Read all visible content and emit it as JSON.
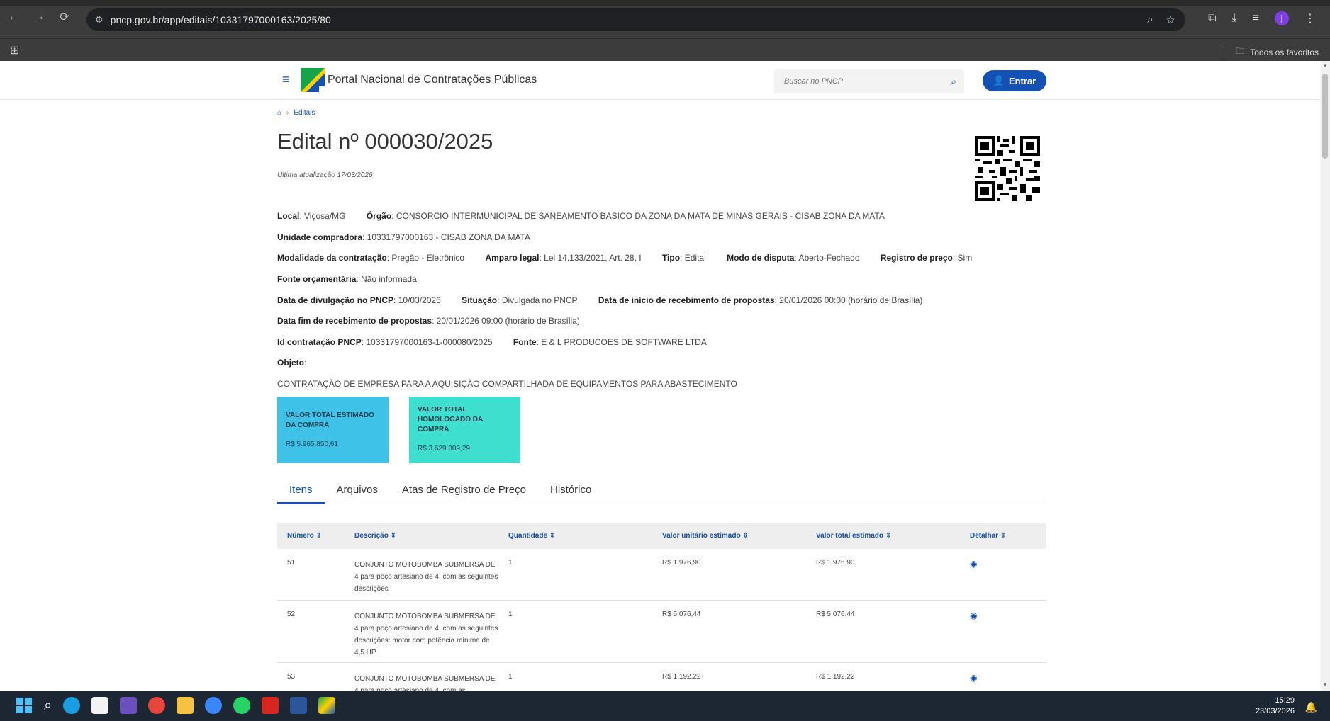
{
  "browser": {
    "url": "pncp.gov.br/app/editais/10331797000163/2025/80",
    "favorites_label": "Todos os favoritos",
    "profile_initial": "j"
  },
  "header": {
    "brand": "Portal Nacional de Contratações Públicas",
    "search_placeholder": "Buscar no PNCP",
    "login_label": "Entrar"
  },
  "breadcrumb": {
    "current": "Editais"
  },
  "edital": {
    "title": "Edital nº 000030/2025",
    "updated": "Última atualização 17/03/2026",
    "fields": {
      "local_label": "Local",
      "local": "Viçosa/MG",
      "orgao_label": "Órgão",
      "orgao": "CONSORCIO INTERMUNICIPAL DE SANEAMENTO BASICO DA ZONA DA MATA DE MINAS GERAIS - CISAB ZONA DA MATA",
      "unidade_label": "Unidade compradora",
      "unidade": "10331797000163 - CISAB ZONA DA MATA",
      "modalidade_label": "Modalidade da contratação",
      "modalidade": "Pregão - Eletrônico",
      "amparo_label": "Amparo legal",
      "amparo": "Lei 14.133/2021, Art. 28, I",
      "tipo_label": "Tipo",
      "tipo": "Edital",
      "modo_label": "Modo de disputa",
      "modo": "Aberto-Fechado",
      "registro_label": "Registro de preço",
      "registro": "Sim",
      "fonte_orc_label": "Fonte orçamentária",
      "fonte_orc": "Não informada",
      "divulgacao_label": "Data de divulgação no PNCP",
      "divulgacao": "10/03/2026",
      "situacao_label": "Situação",
      "situacao": "Divulgada no PNCP",
      "inicio_label": "Data de início de recebimento de propostas",
      "inicio": "20/01/2026 00:00 (horário de Brasília)",
      "fim_label": "Data fim de recebimento de propostas",
      "fim": "20/01/2026 09:00 (horário de Brasília)",
      "id_label": "Id contratação PNCP",
      "id": "10331797000163-1-000080/2025",
      "fonte_label": "Fonte",
      "fonte": "E & L PRODUCOES DE SOFTWARE LTDA",
      "objeto_label": "Objeto",
      "objeto": "CONTRATAÇÃO DE EMPRESA PARA A AQUISIÇÃO COMPARTILHADA DE EQUIPAMENTOS PARA ABASTECIMENTO"
    },
    "cards": {
      "estimado_label": "VALOR TOTAL ESTIMADO DA COMPRA",
      "estimado_value": "R$ 5.965.850,61",
      "homologado_label": "VALOR TOTAL HOMOLOGADO DA COMPRA",
      "homologado_value": "R$ 3.629.809,29",
      "estimado_color": "#3fc2e8",
      "homologado_color": "#3edfcf"
    }
  },
  "tabs": [
    "Itens",
    "Arquivos",
    "Atas de Registro de Preço",
    "Histórico"
  ],
  "table": {
    "headers": [
      "Número",
      "Descrição",
      "Quantidade",
      "Valor unitário estimado",
      "Valor total estimado",
      "Detalhar"
    ],
    "rows": [
      {
        "numero": "51",
        "descricao": "CONJUNTO MOTOBOMBA SUBMERSA DE 4 para poço artesiano de 4, com as seguintes descrições",
        "quantidade": "1",
        "unitario": "R$ 1.976,90",
        "total": "R$ 1.976,90"
      },
      {
        "numero": "52",
        "descricao": "CONJUNTO MOTOBOMBA SUBMERSA DE 4 para poço artesiano de 4, com as seguintes descrições: motor com potência mínima de 4,5 HP",
        "quantidade": "1",
        "unitario": "R$ 5.076,44",
        "total": "R$ 5.076,44"
      },
      {
        "numero": "53",
        "descricao": "CONJUNTO MOTOBOMBA SUBMERSA DE 4 para poço artesiano de 4, com as",
        "quantidade": "1",
        "unitario": "R$ 1.192,22",
        "total": "R$ 1.192,22"
      }
    ]
  },
  "taskbar": {
    "time": "15:29",
    "date": "23/03/2026"
  },
  "colors": {
    "accent": "#1351b4"
  }
}
